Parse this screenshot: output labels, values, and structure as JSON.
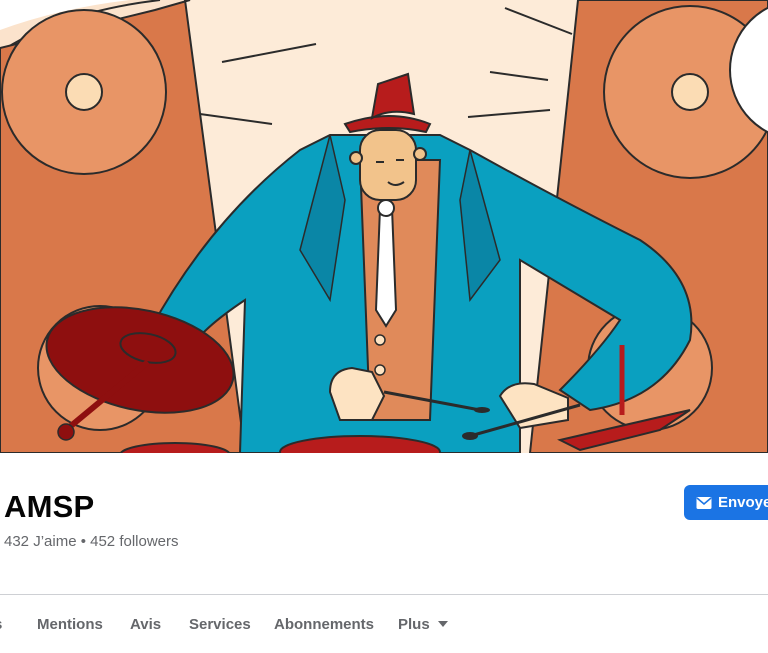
{
  "page": {
    "name": "AMSP",
    "stats": "432 J’aime • 452 followers"
  },
  "actions": {
    "send_label": "Envoyer"
  },
  "tabs": [
    {
      "label": "s"
    },
    {
      "label": "Mentions"
    },
    {
      "label": "Avis"
    },
    {
      "label": "Services"
    },
    {
      "label": "Abonnements"
    },
    {
      "label": "Plus"
    }
  ],
  "colors": {
    "accent": "#1b74e4",
    "cover_background": "#fbe3cc",
    "speaker": "#d9784a",
    "suit": "#0aa0c0",
    "hat": "#b71c1c",
    "cymbal": "#8e0f0f"
  },
  "icons": {
    "send": "messenger-envelope-icon",
    "more": "caret-down-icon"
  }
}
